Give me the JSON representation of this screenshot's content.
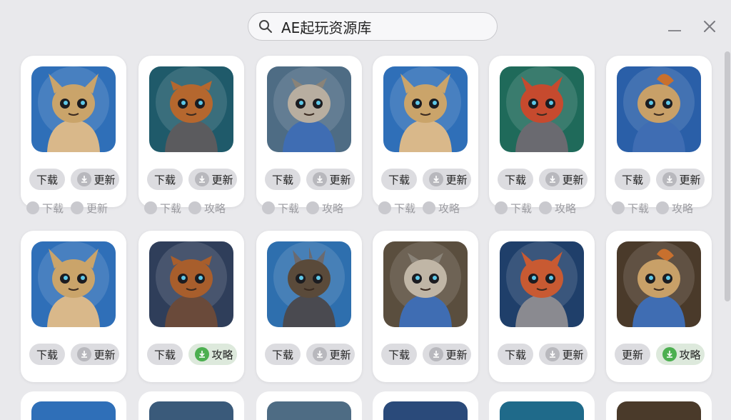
{
  "search": {
    "value": "AE起玩资源库"
  },
  "labels": {
    "download": "下载",
    "update": "更新",
    "guide": "攻略"
  },
  "row1": [
    {
      "char": "horned-owl",
      "bg": "#2f6fb8",
      "body": "#caa46a",
      "cloak": "#d9b88a",
      "btn1": "下载",
      "btn2": "更新"
    },
    {
      "char": "boar",
      "bg": "#1f5a6a",
      "body": "#b5672e",
      "cloak": "#5b5b5e",
      "btn1": "下载",
      "btn2": "更新"
    },
    {
      "char": "spotted-mask",
      "bg": "#4e6c84",
      "body": "#b8aea0",
      "cloak": "#3f6db3",
      "btn1": "下载",
      "btn2": "更新"
    },
    {
      "char": "horned-owl",
      "bg": "#2f6fb8",
      "body": "#caa46a",
      "cloak": "#d9b88a",
      "btn1": "下载",
      "btn2": "更新"
    },
    {
      "char": "red-devil",
      "bg": "#1f6a5a",
      "body": "#c64a2e",
      "cloak": "#6a6a70",
      "btn1": "下载",
      "btn2": "更新"
    },
    {
      "char": "crest-creature",
      "bg": "#2a5fa8",
      "body": "#c8a068",
      "cloak": "#3f6db3",
      "btn1": "下载",
      "btn2": "更新"
    }
  ],
  "ghost_row": [
    {
      "a": "下载",
      "b": "更新"
    },
    {
      "a": "下载",
      "b": "攻略"
    },
    {
      "a": "下载",
      "b": "攻略"
    },
    {
      "a": "下载",
      "b": "攻略"
    },
    {
      "a": "下载",
      "b": "攻略"
    },
    {
      "a": "下载",
      "b": "攻略"
    }
  ],
  "row2": [
    {
      "char": "horned-owl",
      "bg": "#2f6fb8",
      "body": "#caa46a",
      "cloak": "#d9b88a",
      "btn1": "下载",
      "btn2": "更新",
      "attack": false
    },
    {
      "char": "boar",
      "bg": "#2f3e5a",
      "body": "#a85e2c",
      "cloak": "#6a4a3a",
      "btn1": "下载",
      "btn2": "攻略",
      "attack": true
    },
    {
      "char": "spiky-imp",
      "bg": "#2e6fae",
      "body": "#5a4a3a",
      "cloak": "#4a4a50",
      "btn1": "下载",
      "btn2": "更新",
      "attack": false
    },
    {
      "char": "spotted-mask",
      "bg": "#5a4e3e",
      "body": "#c0b6a6",
      "cloak": "#3f6db3",
      "btn1": "下载",
      "btn2": "更新",
      "attack": false
    },
    {
      "char": "armored-devil",
      "bg": "#1f3f6a",
      "body": "#c85a32",
      "cloak": "#8a8a90",
      "btn1": "下载",
      "btn2": "更新",
      "attack": false
    },
    {
      "char": "crest-creature",
      "bg": "#4a3a2a",
      "body": "#c8a068",
      "cloak": "#3f6db3",
      "btn1": "更新",
      "btn2": "攻略",
      "attack": true
    }
  ]
}
